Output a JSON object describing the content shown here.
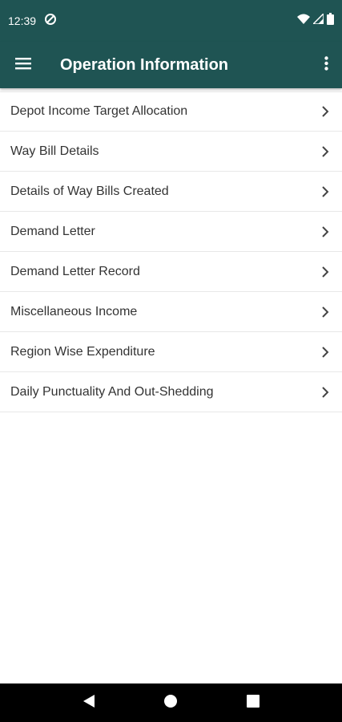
{
  "status_bar": {
    "time": "12:39",
    "icons": [
      "data-saver-icon",
      "wifi-icon",
      "signal-icon",
      "battery-icon"
    ]
  },
  "app_bar": {
    "title": "Operation Information",
    "left_icon": "menu-icon",
    "right_icon": "more-vert-icon",
    "background_color": "#1f5453"
  },
  "list": {
    "items": [
      {
        "label": "Depot Income Target Allocation"
      },
      {
        "label": "Way Bill Details"
      },
      {
        "label": "Details of Way Bills Created"
      },
      {
        "label": "Demand Letter"
      },
      {
        "label": "Demand Letter Record"
      },
      {
        "label": "Miscellaneous Income"
      },
      {
        "label": "Region Wise Expenditure"
      },
      {
        "label": "Daily Punctuality And Out-Shedding"
      }
    ],
    "trailing_icon": "chevron-right-icon"
  },
  "nav_bar": {
    "buttons": [
      "back-icon",
      "home-icon",
      "recents-icon"
    ]
  }
}
